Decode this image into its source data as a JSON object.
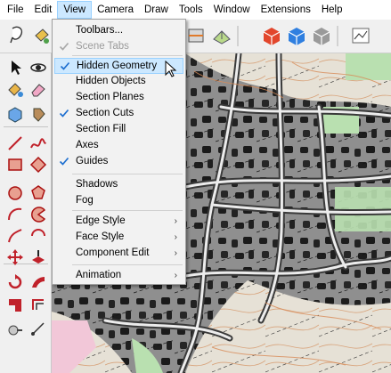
{
  "menubar": {
    "items": [
      "File",
      "Edit",
      "View",
      "Camera",
      "Draw",
      "Tools",
      "Window",
      "Extensions",
      "Help"
    ],
    "active": "View"
  },
  "view_menu": {
    "items": [
      {
        "label": "Toolbars...",
        "checked": false,
        "disabled": false,
        "submenu": false
      },
      {
        "label": "Scene Tabs",
        "checked": true,
        "disabled": true,
        "submenu": false
      },
      {
        "label": "Hidden Geometry",
        "checked": true,
        "disabled": false,
        "submenu": false,
        "highlighted": true
      },
      {
        "label": "Hidden Objects",
        "checked": false,
        "disabled": false,
        "submenu": false
      },
      {
        "label": "Section Planes",
        "checked": false,
        "disabled": false,
        "submenu": false
      },
      {
        "label": "Section Cuts",
        "checked": true,
        "disabled": false,
        "submenu": false
      },
      {
        "label": "Section Fill",
        "checked": false,
        "disabled": false,
        "submenu": false
      },
      {
        "label": "Axes",
        "checked": false,
        "disabled": false,
        "submenu": false
      },
      {
        "label": "Guides",
        "checked": true,
        "disabled": false,
        "submenu": false
      },
      {
        "label": "Shadows",
        "checked": false,
        "disabled": false,
        "submenu": false
      },
      {
        "label": "Fog",
        "checked": false,
        "disabled": false,
        "submenu": false
      },
      {
        "label": "Edge Style",
        "checked": false,
        "disabled": false,
        "submenu": true
      },
      {
        "label": "Face Style",
        "checked": false,
        "disabled": false,
        "submenu": true
      },
      {
        "label": "Component Edit",
        "checked": false,
        "disabled": false,
        "submenu": true
      },
      {
        "label": "Animation",
        "checked": false,
        "disabled": false,
        "submenu": true
      }
    ],
    "arrow_glyph": "›"
  },
  "toolbar": {
    "icons": [
      "lasso-select-icon",
      "paint-bucket-icon",
      "section-display-icon",
      "geo-location-icon",
      "terrain-icon",
      "solid-red-icon",
      "solid-blue-icon",
      "solid-gray-icon"
    ]
  },
  "left_tools": {
    "icons": [
      "select-icon",
      "orbit-icon",
      "paint-icon",
      "eraser-icon",
      "component-icon",
      "tag-icon",
      "line-icon",
      "freehand-icon",
      "rectangle-icon",
      "rotated-rectangle-icon",
      "circle-icon",
      "polygon-icon",
      "arc-icon",
      "pie-icon",
      "arc2-icon",
      "arc3-icon",
      "move-icon",
      "pushpull-icon",
      "rotate-icon",
      "followme-icon",
      "scale-icon",
      "offset-icon",
      "tape-icon",
      "text-icon"
    ]
  },
  "colors": {
    "menu_highlight": "#cce8ff",
    "menu_highlight_border": "#99d1ff",
    "check": "#1e6fd0",
    "map_bg": "#8a8a8a",
    "map_road": "#ececec",
    "map_green": "#b9e0b0",
    "map_pink": "#f2c7d8"
  }
}
